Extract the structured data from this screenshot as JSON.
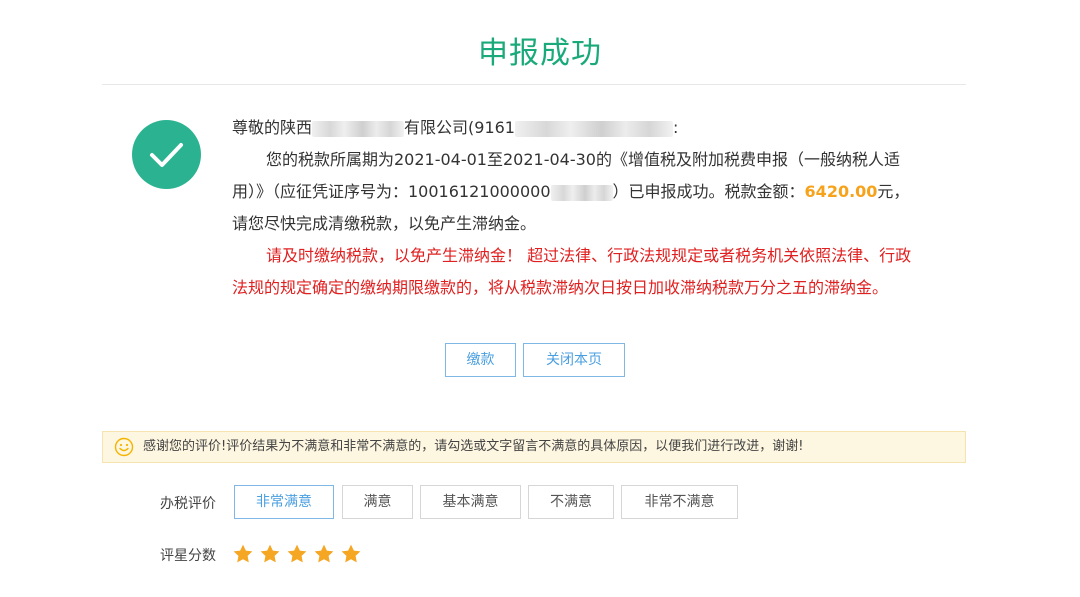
{
  "header": {
    "title": "申报成功"
  },
  "message": {
    "greeting_prefix": "尊敬的陕西",
    "greeting_mid": "有限公司(9161",
    "greeting_suffix": ":",
    "line1": "您的税款所属期为2021-04-01至2021-04-30的《增值税及附加税费申报（一般纳税人适",
    "line2_prefix": "用）》（应征凭证序号为：10016121000000",
    "line2_mid": "）已申报成功。税款金额：",
    "amount": "6420.00",
    "amount_unit": "元，",
    "line3": "请您尽快完成清缴税款，以免产生滞纳金。",
    "warning_line1": "请及时缴纳税款，以免产生滞纳金！ 超过法律、行政法规规定或者税务机关依照法律、行政",
    "warning_line2": "法规的规定确定的缴纳期限缴款的，将从税款滞纳次日按日加收滞纳税款万分之五的滞纳金。"
  },
  "actions": {
    "pay_label": "缴款",
    "close_label": "关闭本页"
  },
  "feedback": {
    "notice": "感谢您的评价!评价结果为不满意和非常不满意的，请勾选或文字留言不满意的具体原因，以便我们进行改进，谢谢!",
    "rating_label": "办税评价",
    "options": [
      "非常满意",
      "满意",
      "基本满意",
      "不满意",
      "非常不满意"
    ],
    "selected": "非常满意",
    "stars_label": "评星分数",
    "stars": 5,
    "stars_max": 5
  },
  "colors": {
    "title": "#1aa97a",
    "success_icon": "#2bb391",
    "amount": "#f7a21b",
    "warning": "#e02020",
    "button_border": "#7fb8e6",
    "button_text": "#4a9fe0",
    "star": "#f5a623",
    "notice_bg": "#fdf6e0"
  },
  "icons": {
    "success": "check-circle-icon",
    "notice": "smile-icon",
    "star": "star-icon"
  }
}
